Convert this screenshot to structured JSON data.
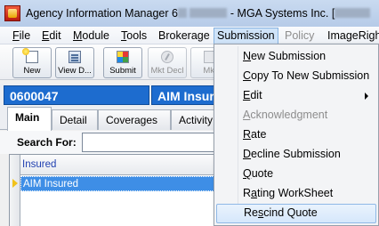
{
  "window": {
    "title_start": "Agency Information Manager 6",
    "title_end": "- MGA Systems Inc. ["
  },
  "menubar": {
    "file": "File",
    "edit": "Edit",
    "module": "Module",
    "tools": "Tools",
    "brokerage": "Brokerage",
    "submission": "Submission",
    "policy": "Policy",
    "imageright": "ImageRight"
  },
  "toolbar": {
    "new": "New",
    "view": "View D...",
    "submit": "Submit",
    "mkt_decl": "Mkt Decl",
    "mkt": "Mkt"
  },
  "policy": {
    "number": "0600047",
    "insured": "AIM Insured"
  },
  "tabs": [
    "Main",
    "Detail",
    "Coverages",
    "Activity"
  ],
  "search": {
    "label": "Search For:",
    "value": ""
  },
  "grid": {
    "column": "Insured",
    "rows": [
      "AIM Insured"
    ]
  },
  "submission_menu": {
    "new_submission": "New Submission",
    "copy_to_new": "Copy To New Submission",
    "edit": "Edit",
    "acknowledgment": "Acknowledgment",
    "rate": "Rate",
    "decline": "Decline Submission",
    "quote": "Quote",
    "rating_worksheet": "Rating WorkSheet",
    "rescind_quote": "Rescind Quote"
  }
}
